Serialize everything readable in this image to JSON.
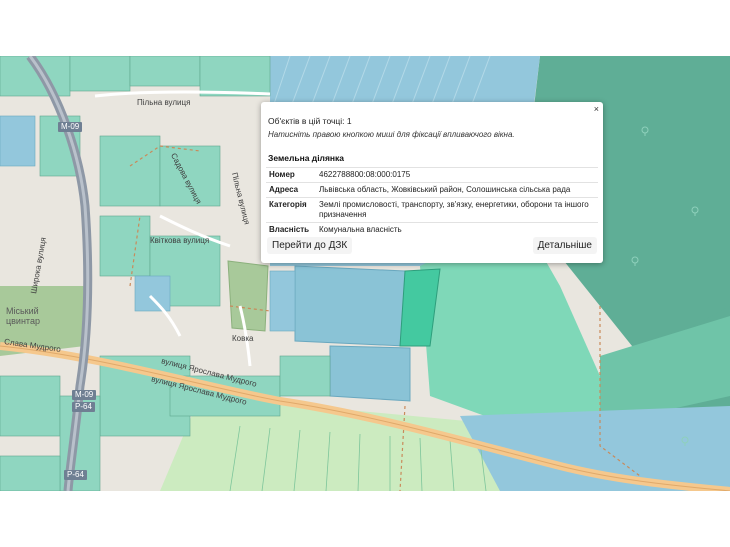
{
  "map": {
    "street_labels": [
      "Пільна вулиця",
      "Садова вулиця",
      "Пільна вулиця",
      "Квіткова вулиця",
      "Широка вулиця",
      "Ковка",
      "вулиця Ярослава Мудрого",
      "вулиця Ярослава Мудрого",
      "Слава Мудрого"
    ],
    "place_label": "Міський цвинтар",
    "road_shields": [
      "М-09",
      "М-09",
      "Р-64",
      "Р-64"
    ],
    "colors": {
      "background": "#e9e6df",
      "parcel_private": "#8fd6c0",
      "parcel_communal": "#93c7dc",
      "parcel_industrial": "#8ac3d6",
      "parcel_agro_green": "#73cdb0",
      "dark_green_forest": "#5fae96",
      "cemetery": "#a8c99a",
      "highlight_parcel": "#44c9a0",
      "highway": "#8e98a6",
      "main_road": "#f5c88d",
      "field_light": "#ccebc0",
      "dashed_boundary": "#c98a5a"
    }
  },
  "popup": {
    "close_label": "×",
    "count_text": "Об'єктів в цій точці: 1",
    "hint_text": "Натисніть правою кнопкою миші для фіксації впливаючого вікна.",
    "section_title": "Земельна ділянка",
    "rows": [
      {
        "key": "Номер",
        "value": "4622788800:08:000:0175"
      },
      {
        "key": "Адреса",
        "value": "Львівська область, Жовківський район, Солошинська сільська рада"
      },
      {
        "key": "Категорія",
        "value": "Землі промисловості, транспорту, зв'язку, енергетики, оборони та іншого призначення"
      },
      {
        "key": "Власність",
        "value": "Комунальна власність"
      }
    ],
    "btn_dzk": "Перейти до ДЗК",
    "btn_details": "Детальніше"
  }
}
